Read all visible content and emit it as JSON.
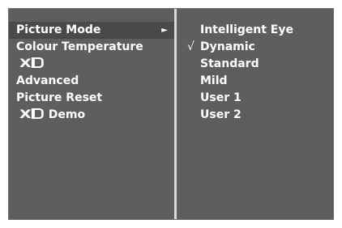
{
  "picture_menu": {
    "items": [
      {
        "label": "Picture Mode",
        "arrow": "►"
      },
      {
        "label": "Colour Temperature"
      },
      {
        "label": "",
        "logo": "XD"
      },
      {
        "label": "Advanced"
      },
      {
        "label": "Picture Reset"
      },
      {
        "label": "Demo",
        "logo": "XD"
      }
    ]
  },
  "picture_mode_submenu": {
    "items": [
      {
        "label": "Intelligent Eye",
        "check": ""
      },
      {
        "label": "Dynamic",
        "check": "√"
      },
      {
        "label": "Standard",
        "check": ""
      },
      {
        "label": "Mild",
        "check": ""
      },
      {
        "label": "User 1",
        "check": ""
      },
      {
        "label": "User 2",
        "check": ""
      }
    ]
  },
  "colors": {
    "background": "#5e5e5e",
    "selected": "#4a4a4a",
    "divider": "#d9d9d9",
    "text": "#ffffff"
  }
}
